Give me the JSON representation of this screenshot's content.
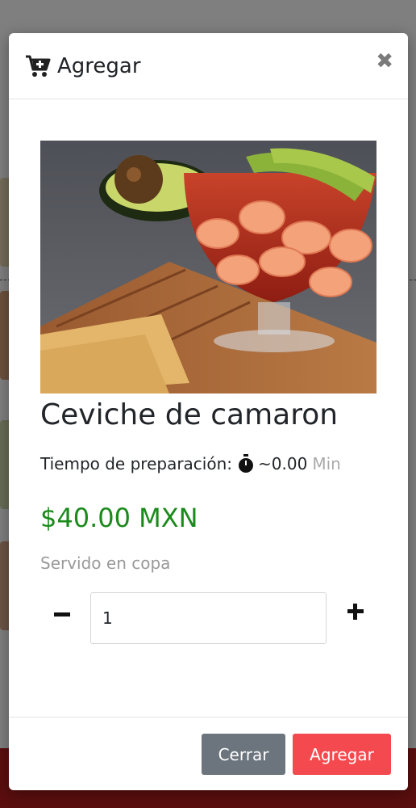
{
  "modal": {
    "title": "Agregar",
    "close_glyph": "✖",
    "header_icon": "cart-plus-icon",
    "close_icon": "close-icon"
  },
  "product": {
    "name": "Ceviche de camaron",
    "prep_label": "Tiempo de preparación:",
    "prep_icon": "stopwatch-icon",
    "prep_value": "~0.00",
    "prep_unit": "Min",
    "price": "$40.00 MXN",
    "description": "Servido en copa",
    "image": "shrimp-ceviche-photo"
  },
  "quantity": {
    "value": "1",
    "minus_icon": "minus-icon",
    "plus_icon": "plus-icon"
  },
  "footer": {
    "close_label": "Cerrar",
    "add_label": "Agregar"
  },
  "colors": {
    "price": "#1a8a1a",
    "add_button": "#f44a4f",
    "close_button": "#6c757d",
    "backdrop_footer": "#b71c1c"
  }
}
